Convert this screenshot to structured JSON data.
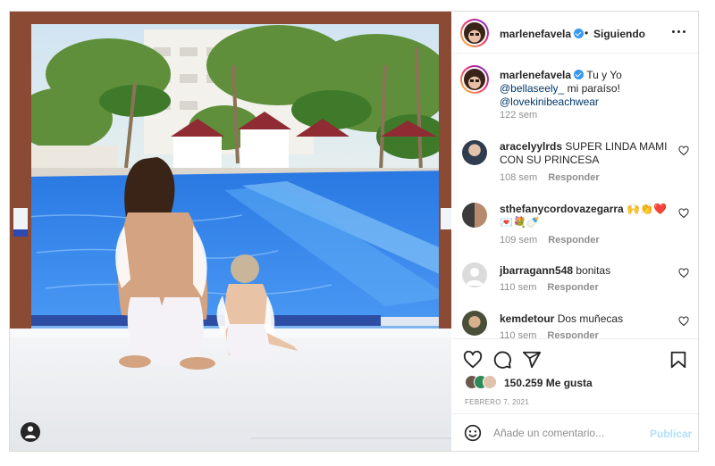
{
  "post": {
    "username": "marlenefavela",
    "dot": "•",
    "follow_state": "Siguiendo",
    "caption_plain": "Tu y Yo ",
    "caption_mention_1": "@bellaseely_",
    "caption_mid": "mi paraíso! ",
    "caption_mention_2": "@lovekinibeachwear",
    "caption_time": "122 sem",
    "likes": "150.259 Me gusta",
    "date": "Febrero 7, 2021",
    "comment_placeholder": "Añade un comentario...",
    "publish_label": "Publicar"
  },
  "comments": [
    {
      "user": "aracelyylrds",
      "text": "SUPER LINDA MAMI CON SU PRINCESA",
      "time": "108 sem",
      "reply": "Responder"
    },
    {
      "user": "sthefanycordovazegarra",
      "text": "🙌👏❤️💌💐🍼",
      "time": "109 sem",
      "reply": "Responder"
    },
    {
      "user": "jbarragann548",
      "text": "bonitas",
      "time": "110 sem",
      "reply": "Responder"
    },
    {
      "user": "kemdetour",
      "text": "Dos muñecas",
      "time": "110 sem",
      "reply": "Responder"
    }
  ],
  "icons": {
    "like": "heart-icon",
    "comment": "comment-icon",
    "share": "share-icon",
    "save": "bookmark-icon",
    "emoji": "emoji-icon",
    "more": "more-options-icon",
    "tags": "user-tag-icon"
  },
  "colors": {
    "verified": "#3897f0",
    "link": "#00376b",
    "muted": "#8e8e8e",
    "publish_disabled": "#b2dffc"
  }
}
